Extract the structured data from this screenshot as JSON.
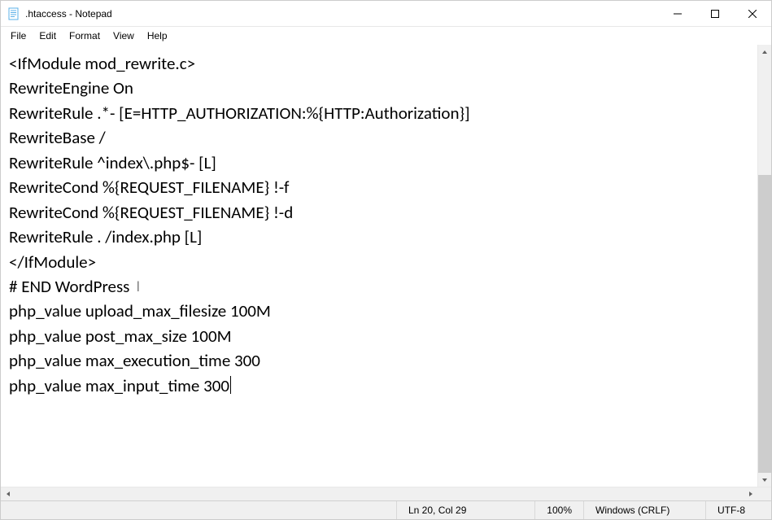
{
  "window": {
    "title": ".htaccess - Notepad"
  },
  "menu": {
    "file": "File",
    "edit": "Edit",
    "format": "Format",
    "view": "View",
    "help": "Help"
  },
  "editor": {
    "lines": [
      "<IfModule mod_rewrite.c>",
      "RewriteEngine On",
      "RewriteRule .*- [E=HTTP_AUTHORIZATION:%{HTTP:Authorization}]",
      "RewriteBase /",
      "RewriteRule ^index\\.php$- [L]",
      "RewriteCond %{REQUEST_FILENAME} !-f",
      "RewriteCond %{REQUEST_FILENAME} !-d",
      "RewriteRule . /index.php [L]",
      "</IfModule>",
      "",
      "# END WordPress",
      "php_value upload_max_filesize 100M",
      "php_value post_max_size 100M",
      "php_value max_execution_time 300",
      "php_value max_input_time 300"
    ],
    "caret_line_index": 14,
    "mouse_cursor_after_line_index": 10
  },
  "scrollbar": {
    "thumb_top_pct": 28,
    "thumb_height_pct": 72
  },
  "status": {
    "position": "Ln 20, Col 29",
    "zoom": "100%",
    "line_ending": "Windows (CRLF)",
    "encoding": "UTF-8"
  }
}
